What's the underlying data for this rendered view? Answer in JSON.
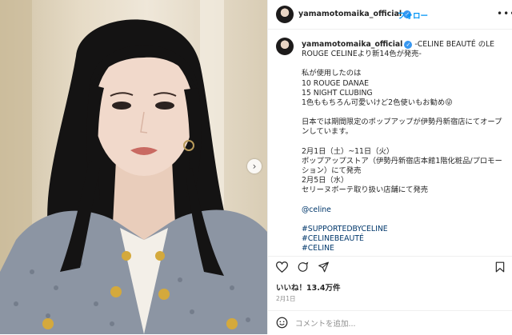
{
  "post": {
    "username": "yamamotomaika_official",
    "follow_label": "フォロー",
    "more_label": "•••",
    "verified_icon": "verified-badge-icon"
  },
  "caption": {
    "username": "yamamotomaika_official",
    "lines": [
      "-CELINE BEAUTÉ のLE ROUGE CELINEより新14色が発売-",
      "私が使用したのは",
      "10 ROUGE DANAE",
      "15 NIGHT CLUBING",
      "1色ももちろん可愛いけど2色使いもお勧め😜",
      "日本では期間限定のポップアップが伊勢丹新宿店にてオープンしています。",
      "2月1日（土）~11日（火）",
      "ポップアップストア（伊勢丹新宿店本館1階化粧品/プロモーション）にて発売",
      "2月5日（水）",
      "セリーヌボーテ取り扱い店舗にて発売"
    ],
    "mention": "@celine",
    "hashtags": [
      "#SUPPORTEDBYCELINE",
      "#CELINEBEAUTÉ",
      "#CELINE"
    ]
  },
  "actions": {
    "like_icon": "heart-icon",
    "comment_icon": "comment-icon",
    "share_icon": "share-icon",
    "save_icon": "bookmark-icon"
  },
  "likes_text": "いいね！13.4万件",
  "date_text": "2月1日",
  "comment": {
    "placeholder": "コメントを追加...",
    "emoji_icon": "smiley-icon"
  },
  "colors": {
    "link": "#0095f6",
    "hashtag": "#00376b",
    "verified": "#3897f0",
    "muted": "#8e8e8e"
  }
}
